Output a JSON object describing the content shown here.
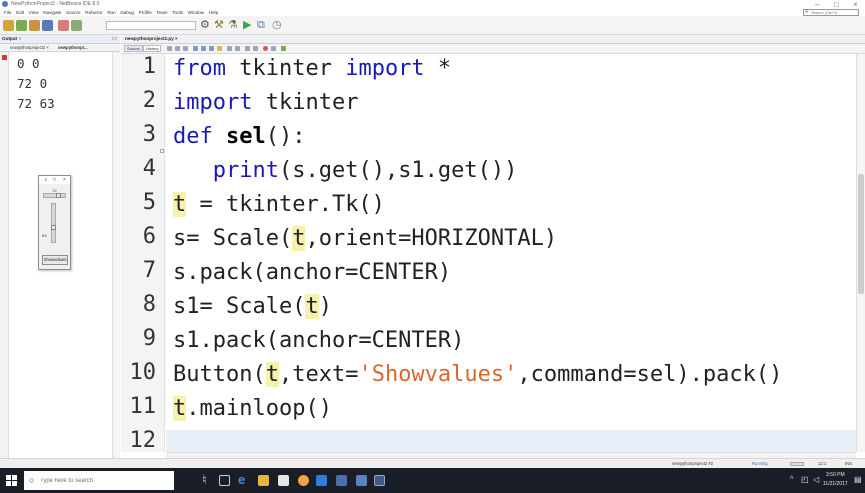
{
  "window": {
    "title": "NewPythonProject2 - NetBeans IDE 8.0",
    "controls": {
      "minimize": "–",
      "maximize": "□",
      "close": "×"
    }
  },
  "menubar": {
    "items": [
      "File",
      "Edit",
      "View",
      "Navigate",
      "Source",
      "Refactor",
      "Run",
      "Debug",
      "Profile",
      "Team",
      "Tools",
      "Window",
      "Help"
    ],
    "search_placeholder": "Search (Ctrl+I)"
  },
  "output_panel": {
    "title": "Output",
    "close": "×",
    "minimize": "▭",
    "tabs": [
      "newpythonproject2 ×",
      "newpythonpr..."
    ],
    "lines": [
      "0 0",
      "72 0",
      "72 63"
    ]
  },
  "tk_window": {
    "feather": "⸙",
    "maximize": "□",
    "close": "×",
    "scale_h_value": "72",
    "scale_h_fraction": 0.72,
    "scale_v_value": "63",
    "scale_v_fraction": 0.63,
    "button_label": "Showvalues"
  },
  "editor": {
    "tab": "newpythonproject2.py ×",
    "source_label": "Source",
    "history_label": "History",
    "line_numbers": [
      "1",
      "2",
      "3",
      "4",
      "5",
      "6",
      "7",
      "8",
      "9",
      "10",
      "11",
      "12"
    ],
    "code": {
      "l1": {
        "kw1": "from",
        "mid": " tkinter ",
        "kw2": "import",
        "rest": " *"
      },
      "l2": {
        "kw": "import",
        "rest": " tkinter"
      },
      "l3": {
        "kw": "def",
        "space": " ",
        "name": "sel",
        "rest": "():"
      },
      "l4": {
        "indent": "   ",
        "kw": "print",
        "rest": "(s.get(),s1.get())"
      },
      "l5": {
        "hl": "t",
        "rest": " = tkinter.Tk()"
      },
      "l6": {
        "pre": "s= Scale(",
        "hl": "t",
        "rest": ",orient=HORIZONTAL)"
      },
      "l7": {
        "text": "s.pack(anchor=CENTER)"
      },
      "l8": {
        "pre": "s1= Scale(",
        "hl": "t",
        "rest": ")"
      },
      "l9": {
        "text": "s1.pack(anchor=CENTER)"
      },
      "l10": {
        "pre": "Button(",
        "hl": "t",
        "mid": ",text=",
        "str": "'Showvalues'",
        "rest": ",command=sel).pack()"
      },
      "l11": {
        "hl": "t",
        "rest": ".mainloop()"
      }
    }
  },
  "statusbar": {
    "project": "newpythonproject2 #2",
    "state": "Running",
    "position": "12:1",
    "mode": "INS"
  },
  "taskbar": {
    "search_placeholder": "Type here to search",
    "time": "3:50 PM",
    "date": "11/21/2017"
  },
  "colors": {
    "keyword": "#1a1ab8",
    "string": "#d8672b",
    "highlight": "#f6f2ae",
    "taskbar": "#1a1f27"
  }
}
